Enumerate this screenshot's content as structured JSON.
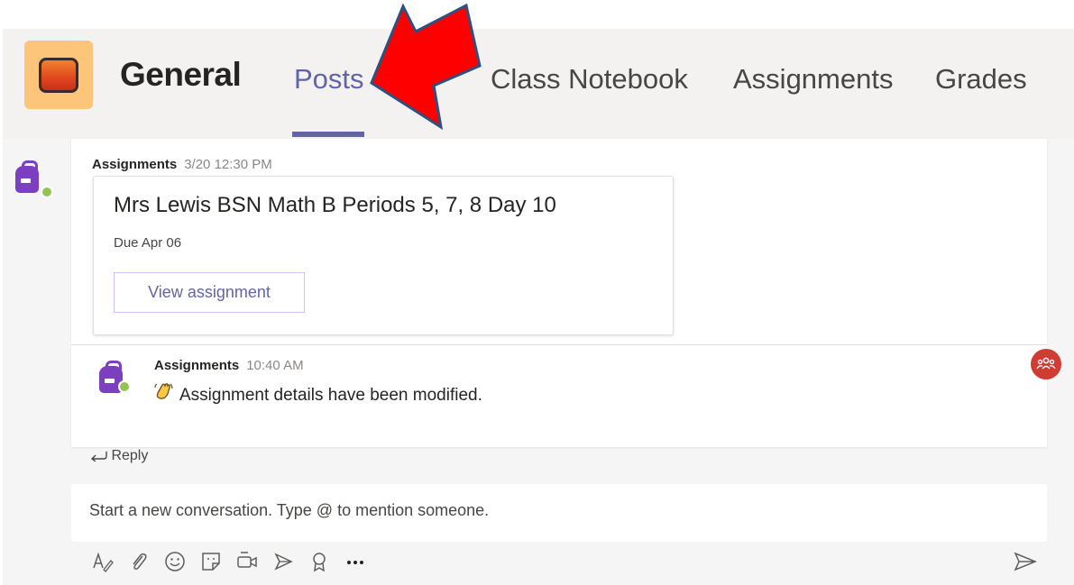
{
  "header": {
    "channel_title": "General",
    "tabs": [
      {
        "label": "Posts",
        "active": true
      },
      {
        "label": "Class Notebook",
        "active": false
      },
      {
        "label": "Assignments",
        "active": false
      },
      {
        "label": "Grades",
        "active": false
      }
    ]
  },
  "posts": [
    {
      "author": "Assignments",
      "time": "3/20 12:30 PM",
      "card": {
        "title": "Mrs Lewis BSN Math B Periods 5, 7, 8 Day 10",
        "due": "Due Apr 06",
        "button_label": "View assignment"
      }
    },
    {
      "author": "Assignments",
      "time": "10:40 AM",
      "message": "Assignment details have been modified."
    }
  ],
  "reply_label": "Reply",
  "compose": {
    "placeholder": "Start a new conversation. Type @ to mention someone."
  },
  "toolbar": {
    "icons": [
      "format-icon",
      "attach-icon",
      "emoji-icon",
      "sticker-icon",
      "meet-now-icon",
      "stream-icon",
      "praise-icon",
      "more-options-icon",
      "send-icon"
    ]
  },
  "colors": {
    "accent": "#6264a7",
    "annotation_arrow": "#ff0000",
    "annotation_arrow_outline": "#2f4f7f",
    "avatar_bag": "#7b3fbf",
    "presence_available": "#92c353",
    "people_badge": "#d13c32"
  }
}
